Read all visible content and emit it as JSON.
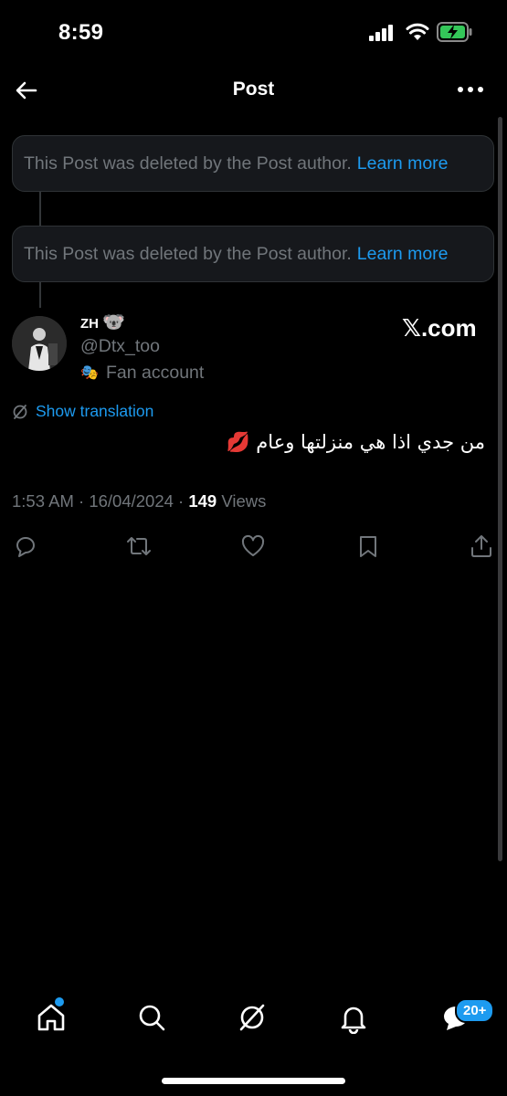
{
  "status_bar": {
    "time": "8:59"
  },
  "header": {
    "title": "Post"
  },
  "deleted_posts": [
    {
      "message": "This Post was deleted by the Post author.",
      "link": "Learn more"
    },
    {
      "message": "This Post was deleted by the Post author.",
      "link": "Learn more"
    }
  ],
  "author": {
    "name": "ZH",
    "name_emoji": "🐨",
    "handle": "@Dtx_too",
    "label_icon": "🎭",
    "label": "Fan account",
    "watermark": "𝕏.com"
  },
  "post": {
    "translation_label": "Show translation",
    "text": "من جدي اذا هي منزلتها وعام 💋",
    "time": "1:53 AM · 16/04/2024 · ",
    "views_count": "149",
    "views_label": " Views"
  },
  "bottom_nav": {
    "badge": "20+"
  },
  "colors": {
    "accent": "#1d9bf0",
    "muted": "#71767b",
    "background": "#000000",
    "card": "#16181c"
  },
  "icons": [
    "back-arrow-icon",
    "more-icon",
    "translate-icon",
    "reply-icon",
    "repost-icon",
    "like-icon",
    "bookmark-icon",
    "share-icon",
    "home-icon",
    "search-icon",
    "grok-icon",
    "notifications-icon",
    "messages-icon"
  ]
}
